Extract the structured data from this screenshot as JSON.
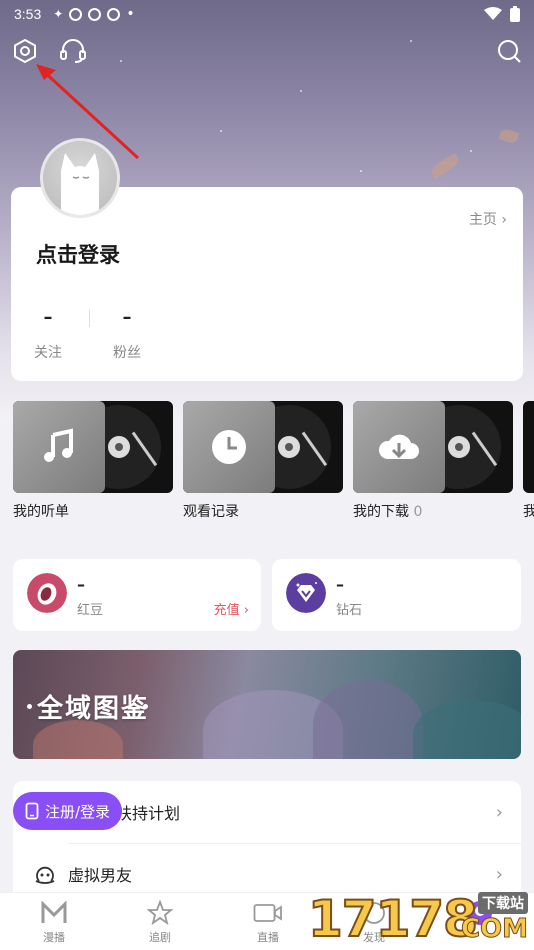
{
  "status_bar": {
    "time": "3:53"
  },
  "profile": {
    "login_prompt": "点击登录",
    "home_link": "主页",
    "stats": [
      {
        "value": "–",
        "label": "关注"
      },
      {
        "value": "–",
        "label": "粉丝"
      }
    ]
  },
  "media": [
    {
      "label": "我的听单",
      "icon": "music-note-icon",
      "count": ""
    },
    {
      "label": "观看记录",
      "icon": "clock-icon",
      "count": ""
    },
    {
      "label": "我的下载",
      "icon": "download-cloud-icon",
      "count": "0"
    },
    {
      "label": "我",
      "icon": "",
      "count": ""
    }
  ],
  "wallet": {
    "red_beans": {
      "value": "–",
      "label": "红豆",
      "action": "充值"
    },
    "diamonds": {
      "value": "–",
      "label": "钻石"
    }
  },
  "banner": {
    "title": "全域图鉴"
  },
  "menu": {
    "items": [
      {
        "label": "扶持计划"
      },
      {
        "label": "虚拟男友"
      }
    ],
    "register_button": "注册/登录"
  },
  "bottom_nav": [
    {
      "label": "漫播",
      "icon": "manbo-logo-icon"
    },
    {
      "label": "追剧",
      "icon": "star-icon"
    },
    {
      "label": "直播",
      "icon": "live-camera-icon"
    },
    {
      "label": "发现",
      "icon": "compass-icon"
    },
    {
      "label": "",
      "icon": "profile-icon"
    }
  ],
  "watermark": {
    "digits": "17178",
    "site": "下载站",
    "domain": "COM"
  },
  "colors": {
    "accent": "#8a4ef5",
    "recharge": "#e8545f"
  }
}
